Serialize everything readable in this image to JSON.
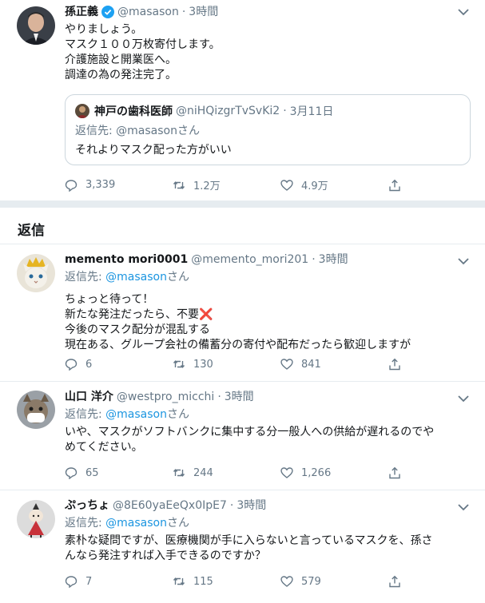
{
  "main_tweet": {
    "name": "孫正義",
    "handle": "@masason",
    "time": "3時間",
    "text": "やりましょう。\nマスク１００万枚寄付します。\n介護施設と開業医へ。\n調達の為の発注完了。",
    "quote": {
      "name": "神戸の歯科医師",
      "handle": "@niHQizgrTvSvKi2",
      "time": "3月11日",
      "reply_prefix": "返信先: ",
      "reply_user": "@masasonさん",
      "text": "それよりマスク配った方がいい"
    },
    "replies": "3,339",
    "retweets": "1.2万",
    "likes": "4.9万"
  },
  "replies_header": "返信",
  "replies": [
    {
      "name": "memento mori0001",
      "handle": "@memento_mori201",
      "time": "3時間",
      "reply_prefix": "返信先: ",
      "reply_user": "@masason",
      "reply_suffix": "さん",
      "text": "ちょっと待って！\n新たな発注だったら、不要❌\n今後のマスク配分が混乱する\n現在ある、グループ会社の備蓄分の寄付や配布だったら歓迎しますが",
      "replies": "6",
      "retweets": "130",
      "likes": "841"
    },
    {
      "name": "山口 洋介",
      "handle": "@westpro_micchi",
      "time": "3時間",
      "reply_prefix": "返信先: ",
      "reply_user": "@masason",
      "reply_suffix": "さん",
      "text": "いや、マスクがソフトバンクに集中する分一般人への供給が遅れるのでや\nめてください。",
      "replies": "65",
      "retweets": "244",
      "likes": "1,266"
    },
    {
      "name": "ぷっちょ",
      "handle": "@8E60yaEeQx0IpE7",
      "time": "3時間",
      "reply_prefix": "返信先: ",
      "reply_user": "@masason",
      "reply_suffix": "さん",
      "text": "素朴な疑問ですが、医療機関が手に入らないと言っているマスクを、孫さ\nんなら発注すれば入手できるのですか？",
      "replies": "7",
      "retweets": "115",
      "likes": "579"
    }
  ],
  "colors": {
    "link": "#1b95e0",
    "secondary_text": "#657786",
    "border": "#e6ecf0",
    "verified": "#1da1f2"
  }
}
